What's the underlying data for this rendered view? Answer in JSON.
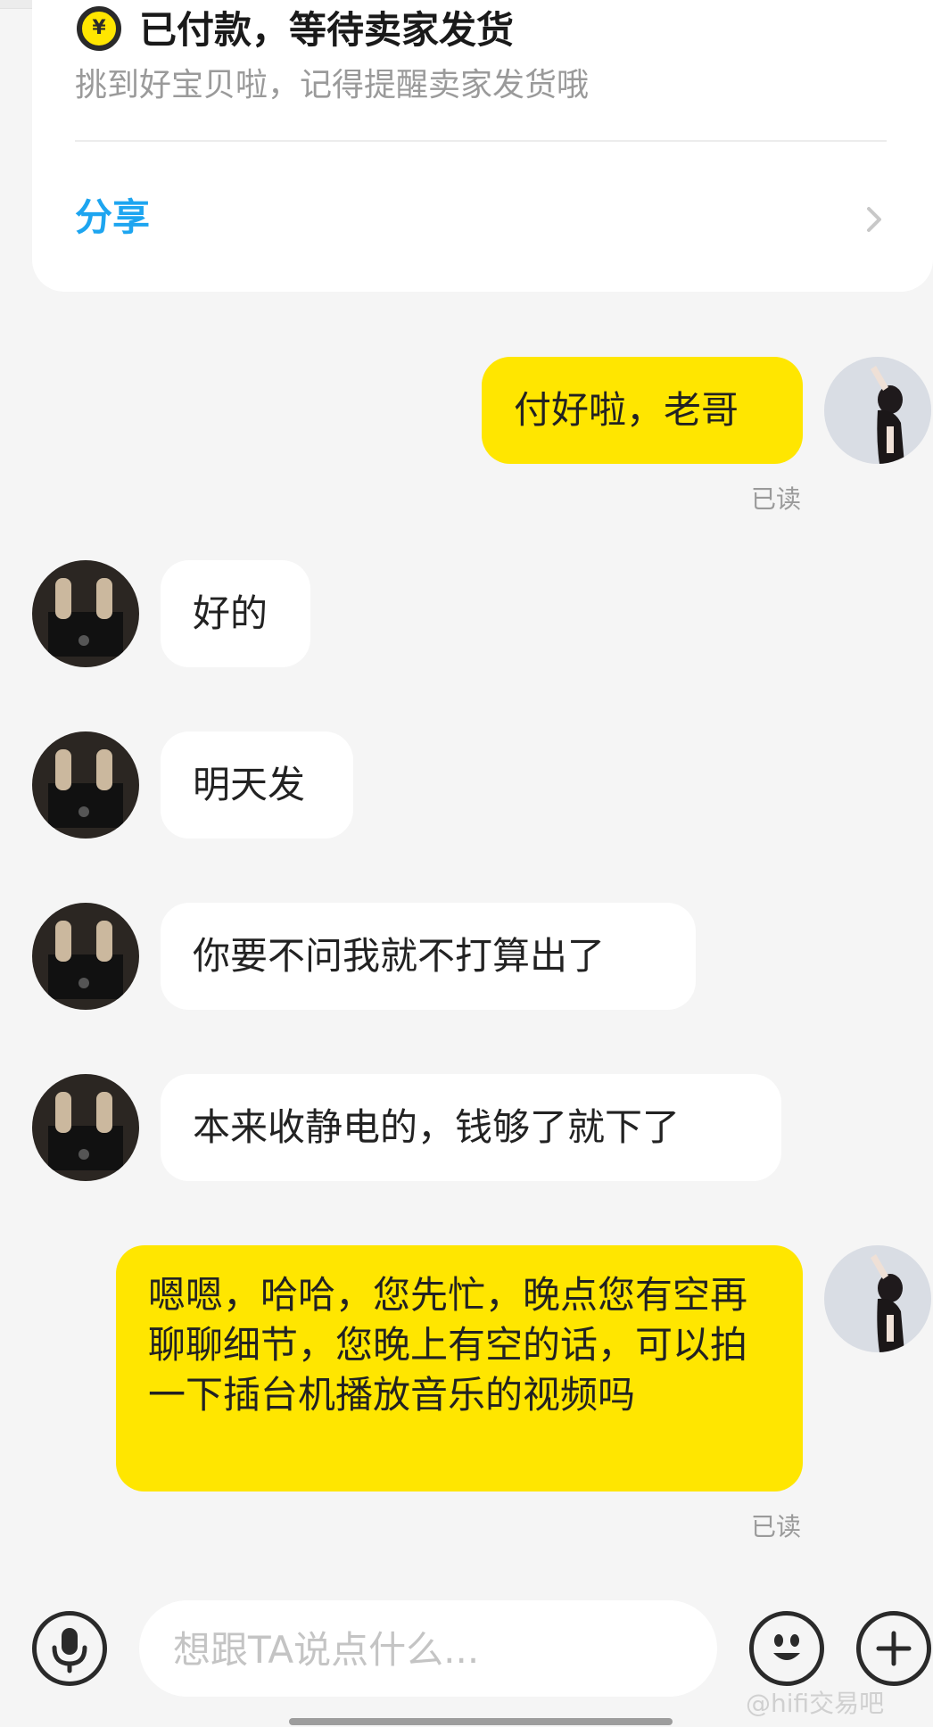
{
  "order_card": {
    "status_title": "已付款，等待卖家发货",
    "status_subtitle": "挑到好宝贝啦，记得提醒卖家发货哦",
    "currency_symbol": "¥",
    "share_label": "分享"
  },
  "messages": [
    {
      "from": "me",
      "text": "付好啦，老哥",
      "status": "已读"
    },
    {
      "from": "seller",
      "text": "好的"
    },
    {
      "from": "seller",
      "text": "明天发"
    },
    {
      "from": "seller",
      "text": "你要不问我就不打算出了"
    },
    {
      "from": "seller",
      "text": "本来收静电的，钱够了就下了"
    },
    {
      "from": "me",
      "text": "嗯嗯，哈哈，您先忙，晚点您有空再聊聊细节，您晚上有空的话，可以拍一下插台机播放音乐的视频吗",
      "status": "已读"
    }
  ],
  "input_bar": {
    "placeholder": "想跟TA说点什么..."
  },
  "watermark": "@hifi交易吧",
  "icons": {
    "voice": "microphone-icon",
    "emoji": "emoji-icon",
    "more": "plus-icon",
    "share": "chevron-right-icon"
  },
  "colors": {
    "accent": "#ffe600",
    "share_blue": "#1da5f0",
    "background": "#f5f5f5"
  }
}
